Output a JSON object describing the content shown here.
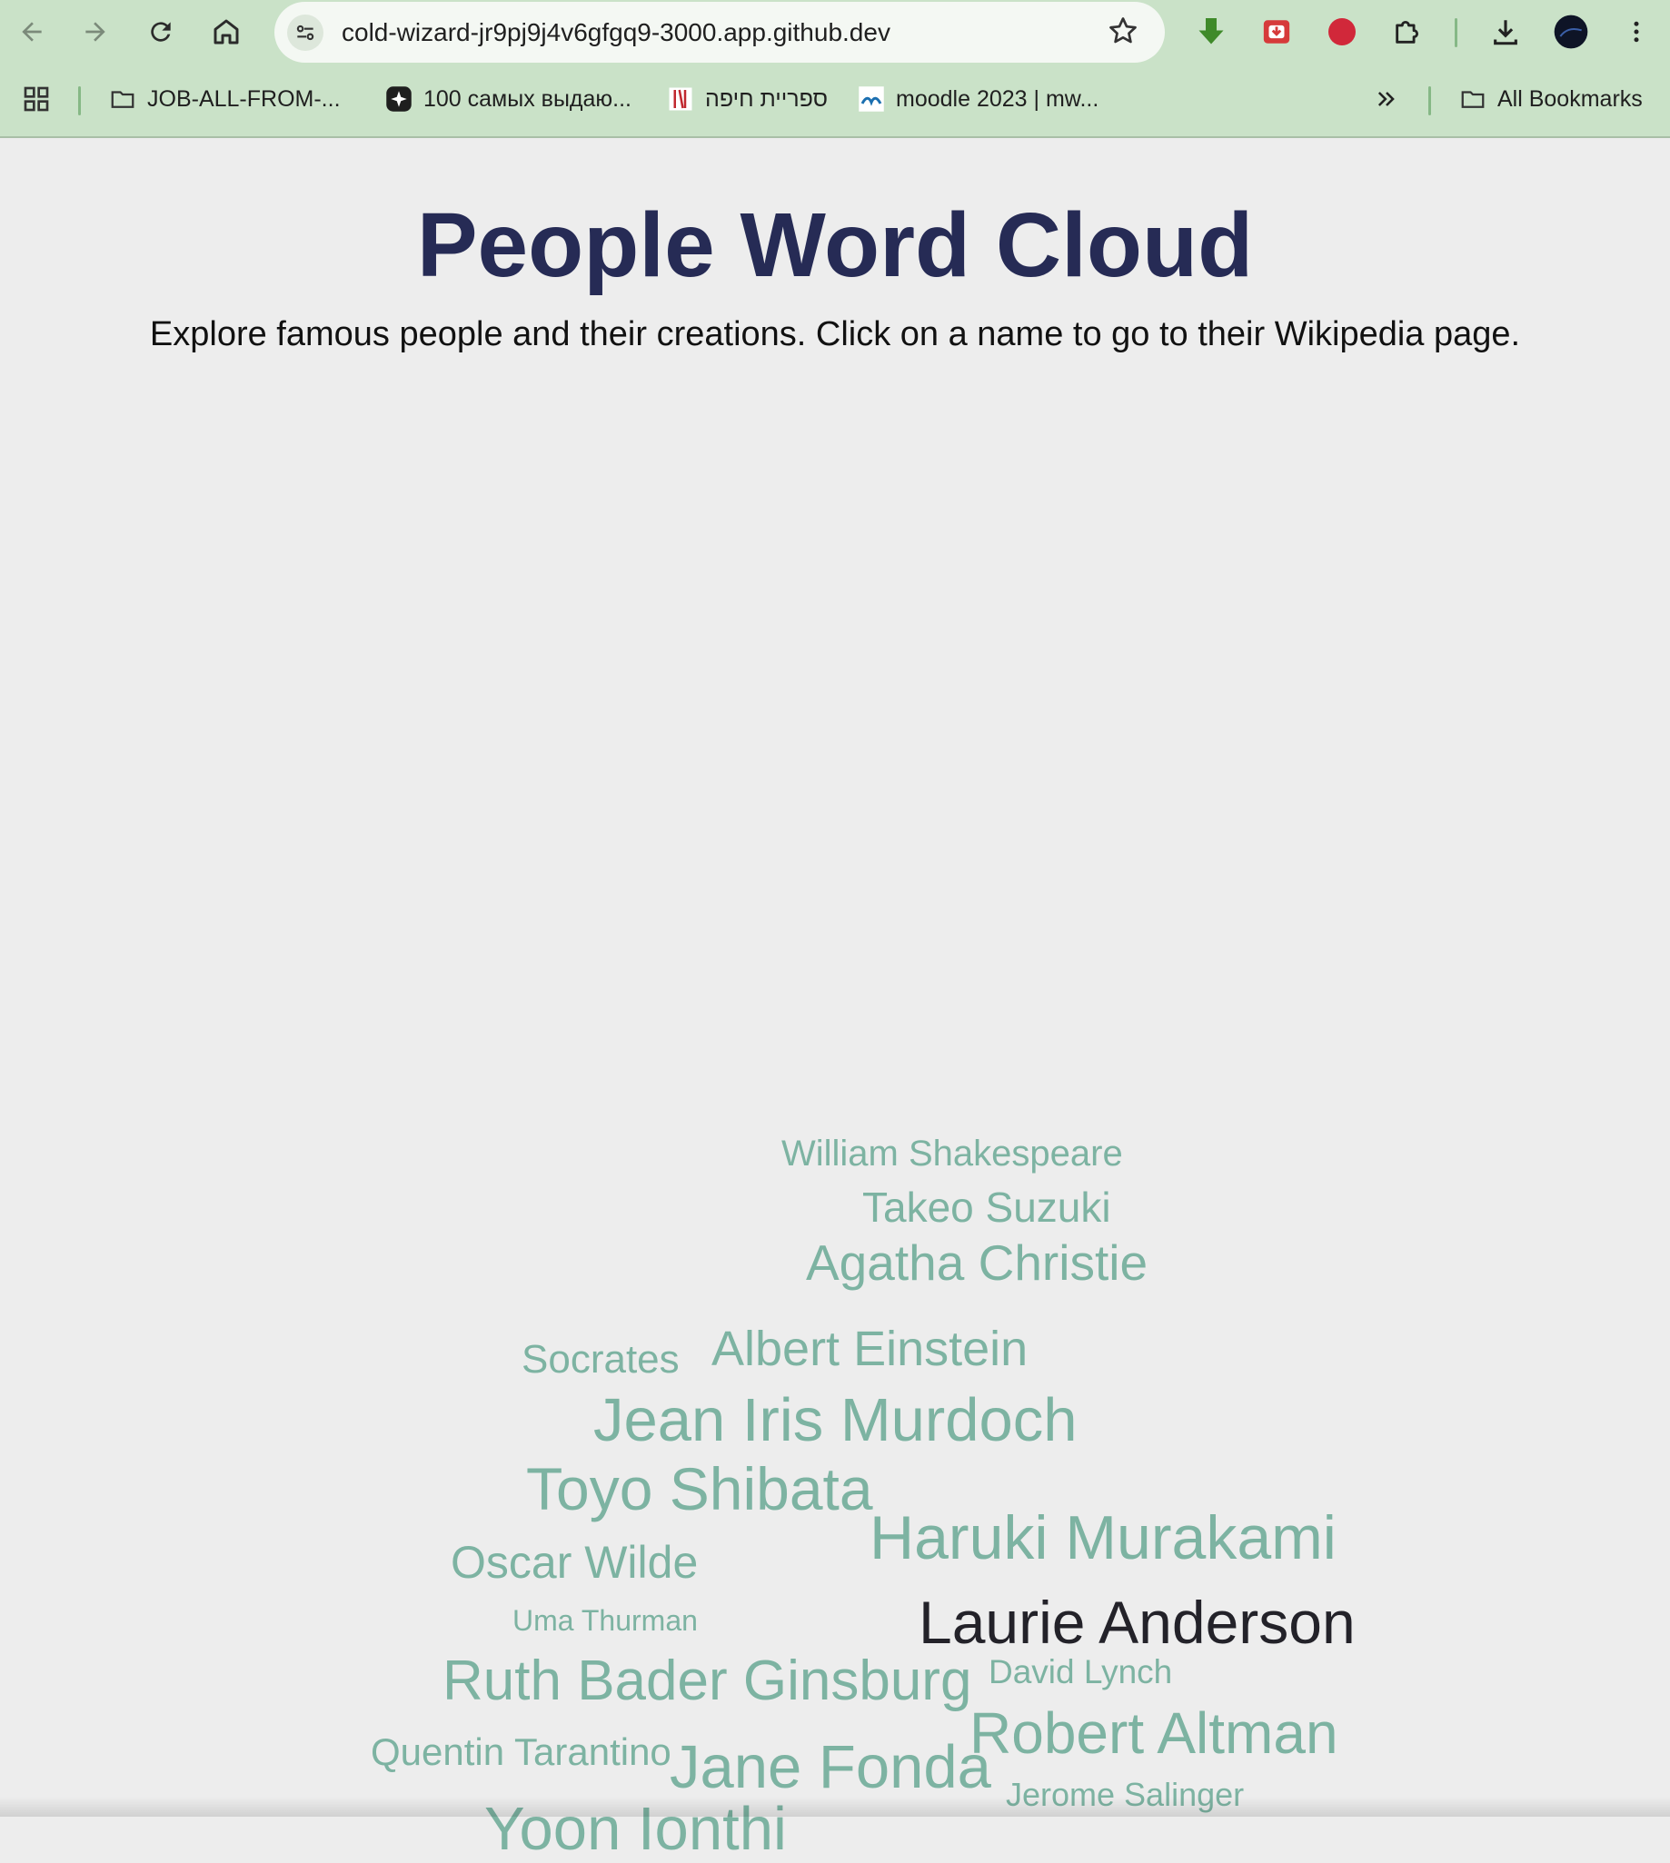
{
  "browser": {
    "url": "cold-wizard-jr9pj9j4v6gfgq9-3000.app.github.dev",
    "back_icon": "arrow-left-icon",
    "forward_icon": "arrow-right-icon",
    "reload_icon": "reload-icon",
    "home_icon": "home-icon",
    "bookmarks": [
      {
        "label": "JOB-ALL-FROM-...",
        "icon": "folder-icon"
      },
      {
        "label": "100 самых выдаю...",
        "icon": "sparkle-icon"
      },
      {
        "label": "ספריית חיפה",
        "icon": "library-icon"
      },
      {
        "label": "moodle 2023 | mw...",
        "icon": "moodle-icon"
      }
    ],
    "all_bookmarks": "All Bookmarks"
  },
  "page": {
    "title": "People Word Cloud",
    "subtitle": "Explore famous people and their creations. Click on a name to go to their Wikipedia page."
  },
  "colors": {
    "word": "#7db3a2",
    "word_hover": "#232229",
    "title": "#262b55",
    "chrome": "#cae2c8"
  },
  "cloud": {
    "words": [
      {
        "name": "William Shakespeare",
        "state": "normal"
      },
      {
        "name": "Takeo Suzuki",
        "state": "normal"
      },
      {
        "name": "Agatha Christie",
        "state": "normal"
      },
      {
        "name": "Socrates",
        "state": "normal"
      },
      {
        "name": "Albert Einstein",
        "state": "normal"
      },
      {
        "name": "Jean Iris Murdoch",
        "state": "normal"
      },
      {
        "name": "Toyo Shibata",
        "state": "normal"
      },
      {
        "name": "Haruki Murakami",
        "state": "normal"
      },
      {
        "name": "Oscar Wilde",
        "state": "normal"
      },
      {
        "name": "Uma Thurman",
        "state": "normal"
      },
      {
        "name": "Laurie Anderson",
        "state": "hover"
      },
      {
        "name": "Ruth Bader Ginsburg",
        "state": "normal"
      },
      {
        "name": "David Lynch",
        "state": "normal"
      },
      {
        "name": "Robert Altman",
        "state": "normal"
      },
      {
        "name": "Quentin Tarantino",
        "state": "normal"
      },
      {
        "name": "Jane Fonda",
        "state": "normal"
      },
      {
        "name": "Jerome Salinger",
        "state": "normal"
      },
      {
        "name": "Yoon Ionthi",
        "state": "normal"
      }
    ]
  }
}
